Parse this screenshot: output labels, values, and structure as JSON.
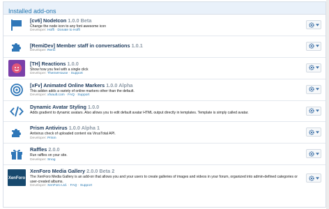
{
  "panel": {
    "title": "Installed add-ons"
  },
  "labels": {
    "developer": "Developer:",
    "sep": "·"
  },
  "addons": [
    {
      "name": "[cv6] NodeIcon",
      "version": "1.0.0 Beta",
      "description": "Change the node icon to any font awesome icon",
      "developer": "Hoffi",
      "links": [
        "Donate to Hoffi"
      ],
      "icon": "flag-icon"
    },
    {
      "name": "[RemiDev] Member staff in conversations",
      "version": "1.0.1",
      "description": "",
      "developer": "Remi",
      "links": [],
      "icon": "puzzle-icon"
    },
    {
      "name": "[TH] Reactions",
      "version": "1.0.0",
      "description": "Show how you feel with a single click",
      "developer": "ThemeHouse",
      "links": [
        "Support"
      ],
      "icon": "reactions-logo"
    },
    {
      "name": "[xFv] Animated Online Markers",
      "version": "1.0.0 Alpha",
      "description": "This addon adds a variety of online markers other than the default.",
      "developer": "xfvault.com",
      "links": [
        "FAQ",
        "Support"
      ],
      "icon": "target-icon"
    },
    {
      "name": "Dynamic Avatar Styling",
      "version": "1.0.0",
      "description": "Adds gradient to dynamic avatars. Also allows you to edit default avatar HTML output directly in templates. Template is simply called avatar.",
      "developer": "",
      "links": [],
      "icon": "code-icon"
    },
    {
      "name": "Prism Antivirus",
      "version": "1.0.0 Alpha 1",
      "description": "Antivirus check of uploaded content via VirusTotal API.",
      "developer": "Prism",
      "links": [],
      "icon": "puzzle-icon"
    },
    {
      "name": "Raffles",
      "version": "2.0.0",
      "description": "Run raffles on your site.",
      "developer": "Snog",
      "links": [],
      "icon": "gift-icon"
    },
    {
      "name": "XenForo Media Gallery",
      "version": "2.0.0 Beta 2",
      "description": "The XenForo Media Gallery is an add-on that allows you and your users to create galleries of images and videos in your forum, organized into admin-defined categories or user-created albums.",
      "developer": "XenForo Ltd.",
      "links": [
        "FAQ",
        "Support"
      ],
      "icon": "xenforo-logo",
      "icon_text": "XenForo"
    }
  ]
}
